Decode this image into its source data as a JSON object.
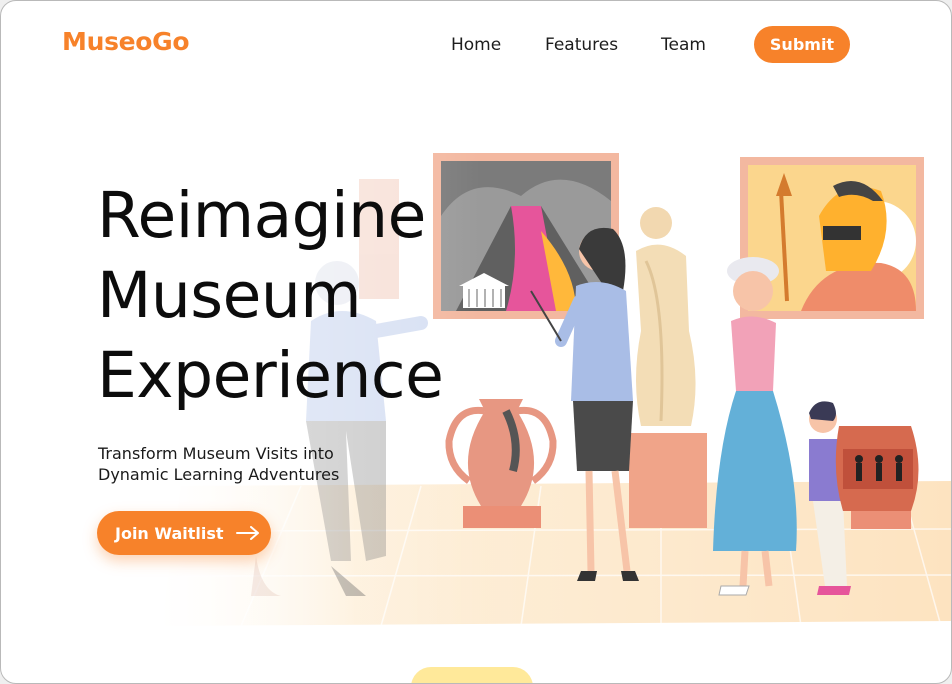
{
  "brand": {
    "logo_text": "MuseoGo",
    "accent_color": "#f7822a"
  },
  "nav": {
    "links": [
      {
        "label": "Home"
      },
      {
        "label": "Features"
      },
      {
        "label": "Team"
      }
    ],
    "submit_label": "Submit"
  },
  "hero": {
    "title_lines": [
      "Reimagine",
      "Museum",
      "Experience"
    ],
    "subtitle_lines": [
      "Transform Museum Visits into",
      "Dynamic Learning Adventures"
    ],
    "cta_label": "Join Waitlist",
    "cta_icon": "arrow-right-icon"
  },
  "illustration": {
    "icons": [
      "volcano-painting",
      "statue",
      "spartan-warrior-painting",
      "amphora-vase",
      "greek-pottery",
      "tour-guide",
      "visitor-woman",
      "child-visitor",
      "visitor-man"
    ]
  }
}
